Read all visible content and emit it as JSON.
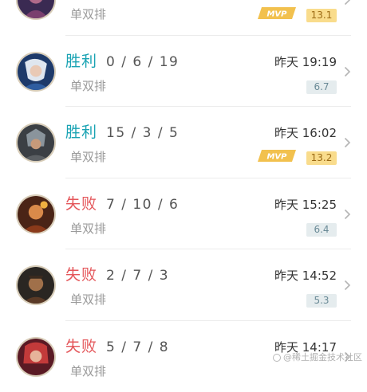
{
  "matches": [
    {
      "result": "",
      "kda": "",
      "time": "",
      "mode": "单双排",
      "score": "13.1",
      "mvp": true,
      "avatar_icon": "champion-portrait-icon",
      "mvp_label": "MVP"
    },
    {
      "result": "胜利",
      "kda": "0 / 6 / 19",
      "time": "昨天 19:19",
      "mode": "单双排",
      "score": "6.7",
      "mvp": false,
      "avatar_icon": "champion-portrait-icon"
    },
    {
      "result": "胜利",
      "kda": "15 / 3 / 5",
      "time": "昨天 16:02",
      "mode": "单双排",
      "score": "13.2",
      "mvp": true,
      "avatar_icon": "champion-portrait-icon",
      "mvp_label": "MVP"
    },
    {
      "result": "失败",
      "kda": "7 / 10 / 6",
      "time": "昨天 15:25",
      "mode": "单双排",
      "score": "6.4",
      "mvp": false,
      "avatar_icon": "champion-portrait-icon"
    },
    {
      "result": "失败",
      "kda": "2 / 7 / 3",
      "time": "昨天 14:52",
      "mode": "单双排",
      "score": "5.3",
      "mvp": false,
      "avatar_icon": "champion-portrait-icon"
    },
    {
      "result": "失败",
      "kda": "5 / 7 / 8",
      "time": "昨天 14:17",
      "mode": "单双排",
      "score": "",
      "mvp": false,
      "avatar_icon": "champion-portrait-icon"
    }
  ],
  "colors": {
    "win": "#1aa3b3",
    "lose": "#e4565a",
    "mvp_score_bg": "#f9dc8c",
    "score_bg": "#e5ecee"
  },
  "watermark": "@稀土掘金技术社区"
}
